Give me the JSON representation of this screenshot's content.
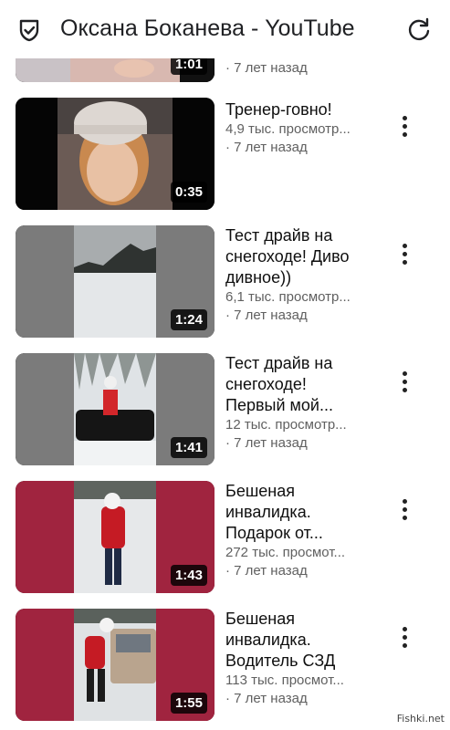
{
  "header": {
    "title": "Оксана Боканева - YouTube",
    "shield_icon": "shield-check-icon",
    "refresh_icon": "refresh-icon"
  },
  "videos": [
    {
      "title_lines": [],
      "views": "",
      "age": "· 7 лет назад",
      "duration": "1:01"
    },
    {
      "title_lines": [
        "Тренер-говно!"
      ],
      "views": "4,9 тыс. просмотр...",
      "age": "· 7 лет назад",
      "duration": "0:35"
    },
    {
      "title_lines": [
        "Тест драйв на",
        "снегоходе! Диво",
        "дивное))"
      ],
      "views": "6,1 тыс. просмотр...",
      "age": "· 7 лет назад",
      "duration": "1:24"
    },
    {
      "title_lines": [
        "Тест драйв на",
        "снегоходе!",
        "Первый мой..."
      ],
      "views": "12 тыс. просмотр...",
      "age": "· 7 лет назад",
      "duration": "1:41"
    },
    {
      "title_lines": [
        "Бешеная",
        "инвалидка.",
        "Подарок от..."
      ],
      "views": "272 тыс. просмот...",
      "age": "· 7 лет назад",
      "duration": "1:43"
    },
    {
      "title_lines": [
        "Бешеная",
        "инвалидка.",
        "Водитель СЗД"
      ],
      "views": "113 тыс. просмот...",
      "age": "· 7 лет назад",
      "duration": "1:55"
    }
  ],
  "watermark": "Fishki.net",
  "colors": {
    "accent_maroon": "#a0243f",
    "gray_side": "#808080"
  }
}
